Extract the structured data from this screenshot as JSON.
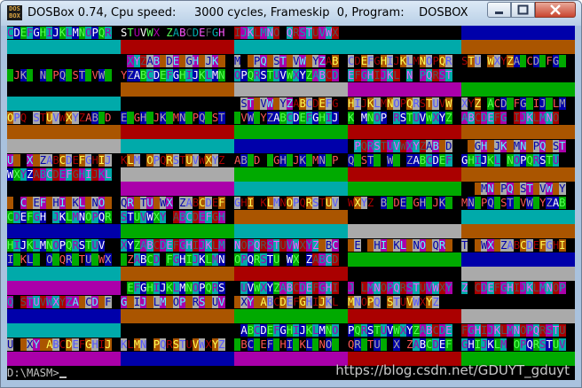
{
  "window": {
    "title": "DOSBox 0.74, Cpu speed:     3000 cycles, Frameskip  0, Program:    DOSBOX",
    "icon_label": "DOS BOX"
  },
  "palette": [
    "#000000",
    "#0000aa",
    "#00aa00",
    "#00aaaa",
    "#aa0000",
    "#aa00aa",
    "#aa5500",
    "#aaaaaa",
    "#555555",
    "#5555ff",
    "#55ff55",
    "#55ffff",
    "#ff5555",
    "#ff55ff",
    "#ffff55",
    "#ffffff"
  ],
  "alphabet": "ABCDEFGHIJKLMNOPQRSTUVWXYZ",
  "band_colors": [
    "#aa00aa",
    "#0000aa",
    "#aa5500",
    "#aaaaaa",
    "#00aa00",
    "#000000",
    "#00aaaa",
    "#aa0000"
  ],
  "screen_rows": [
    {
      "bands": [
        -1,
        5,
        -1,
        5,
        1
      ],
      "text": [
        [
          0,
          "CDEFGHIJKLMNOPQRSTUVWX ZABCDEFGHIJKLMNO QRSTUVWX"
        ]
      ]
    },
    {
      "bands": [
        6,
        7,
        6,
        6,
        2
      ],
      "text": []
    },
    {
      "bands": [
        -1,
        -1,
        -1,
        -1,
        -1
      ],
      "text": [
        [
          17,
          "XYZABCDEFGHIJKLM OPQRSTUVWXYZABCDEFGHIJKLMNOPQRSTU WXYZABCDEFGH"
        ]
      ]
    },
    {
      "bands": [
        -1,
        -1,
        -1,
        -1,
        -1
      ],
      "text": [
        [
          0,
          "IJKL NOPQRSTUVWXYZABCDEFGHIJKLMNOPQRSTUVWXYZABCDEFGHIJKL N PQRST"
        ]
      ]
    },
    {
      "bands": [
        -1,
        2,
        3,
        0,
        4
      ],
      "text": []
    },
    {
      "bands": [
        6,
        5,
        -1,
        -1,
        -1
      ],
      "text": [
        [
          33,
          "STUVWXYZABCDEFGHIJKLMNOPQRSTUVWXYZ ACDEFGHIJKLMN"
        ]
      ]
    },
    {
      "bands": [
        -1,
        -1,
        -1,
        -1,
        -1
      ],
      "text": [
        [
          0,
          "OPQ STUVWXYZABCDEFGHIJKLMNOPQRSTUVWXYZABCDEFGHIJK MNOP RSTUVWXYZABCDEFG IJKLMNO"
        ]
      ]
    },
    {
      "bands": [
        2,
        7,
        4,
        7,
        2
      ],
      "text": []
    },
    {
      "bands": [
        3,
        6,
        1,
        -1,
        -1
      ],
      "text": [
        [
          49,
          "PQRSTUVWXYZABCD FGHIJKLMNOPQRST"
        ]
      ]
    },
    {
      "bands": [
        -1,
        -1,
        -1,
        -1,
        -1
      ],
      "text": [
        [
          0,
          "UV XYZABCDEFGHIJKLM OPQRSTUVWXYZABCD FGHIJKLMNOPQRSTU WX ZABCDEFGHIJKL NOPQRSTU"
        ]
      ]
    },
    {
      "bands": [
        -1,
        3,
        4,
        7,
        2
      ],
      "text": [
        [
          0,
          "WXYZABCDEFGHIJKL"
        ]
      ]
    },
    {
      "bands": [
        5,
        0,
        6,
        4,
        -1
      ],
      "text": [
        [
          66,
          "LMNOPQRSTUVWXYZ"
        ]
      ]
    },
    {
      "bands": [
        -1,
        -1,
        -1,
        -1,
        -1
      ],
      "text": [
        [
          0,
          "A CDEFGHIJKLMNOPQRSTUVWX ZABCDEFGHI KLMNOPQRSTUVWXYZ BCDEFGHIJKLMNOPQRSTUVWXYZAB"
        ]
      ]
    },
    {
      "bands": [
        -1,
        -1,
        2,
        5,
        6
      ],
      "text": [
        [
          0,
          "CDEFGH JKLMNOPQRSTUVWXY ABCDEFGH"
        ]
      ]
    },
    {
      "bands": [
        1,
        4,
        6,
        3,
        2
      ],
      "text": []
    },
    {
      "bands": [
        -1,
        -1,
        -1,
        -1,
        -1
      ],
      "text": [
        [
          0,
          "HIJKLMNOPQRSTUV XYZABCDEFGHIJKLMNOPQRSTUVWXYZABCDE GHIJKLMNOPQRST VWXYZABCDEFGHIJ"
        ]
      ]
    },
    {
      "bands": [
        -1,
        -1,
        -1,
        4,
        1
      ],
      "text": [
        [
          0,
          "IJKLM OPQRSTUVWXYZABCD FGHIJKLMNOPQRSTU WX ZABCD"
        ]
      ]
    },
    {
      "bands": [
        6,
        2,
        7,
        5,
        3
      ],
      "text": []
    },
    {
      "bands": [
        0,
        -1,
        -1,
        -1,
        -1
      ],
      "text": [
        [
          17,
          "EFGHIJKLMNOPQRS UVWXYZABCDEFGHIJ LMNOPQRSTUVWXYZ CDEFGHIJKLMNOP"
        ]
      ]
    },
    {
      "bands": [
        -1,
        -1,
        -1,
        -1,
        -1
      ],
      "text": [
        [
          0,
          "Q STUVWXYZABCDEFGHIJKLMNOPQRSTUVWXYZABCDEFGHIJKLMNOPQ STUVWXYZ"
        ]
      ]
    },
    {
      "bands": [
        1,
        2,
        4,
        7,
        3
      ],
      "text": []
    },
    {
      "bands": [
        6,
        5,
        -1,
        -1,
        -1
      ],
      "text": [
        [
          33,
          "ABCDEFGHIJKLMNOPQRSTUVWXYZABCDEFGHIJKLMNOPQRSTUVWXYZ"
        ]
      ]
    },
    {
      "bands": [
        -1,
        -1,
        -1,
        -1,
        -1
      ],
      "text": [
        [
          0,
          "U WXYZABCDEFGHIJKLMN PQRSTUVWXYZABCDEFGHIJKLMNOPQRSTUV X ZABCDEFGHIJKLM OPQRSTUV"
        ]
      ]
    },
    {
      "bands": [
        0,
        1,
        0,
        7,
        4
      ],
      "text": []
    }
  ],
  "prompt": "D:\\MASM>",
  "watermark": "https://blog.csdn.net/GDUYT_gduyt"
}
